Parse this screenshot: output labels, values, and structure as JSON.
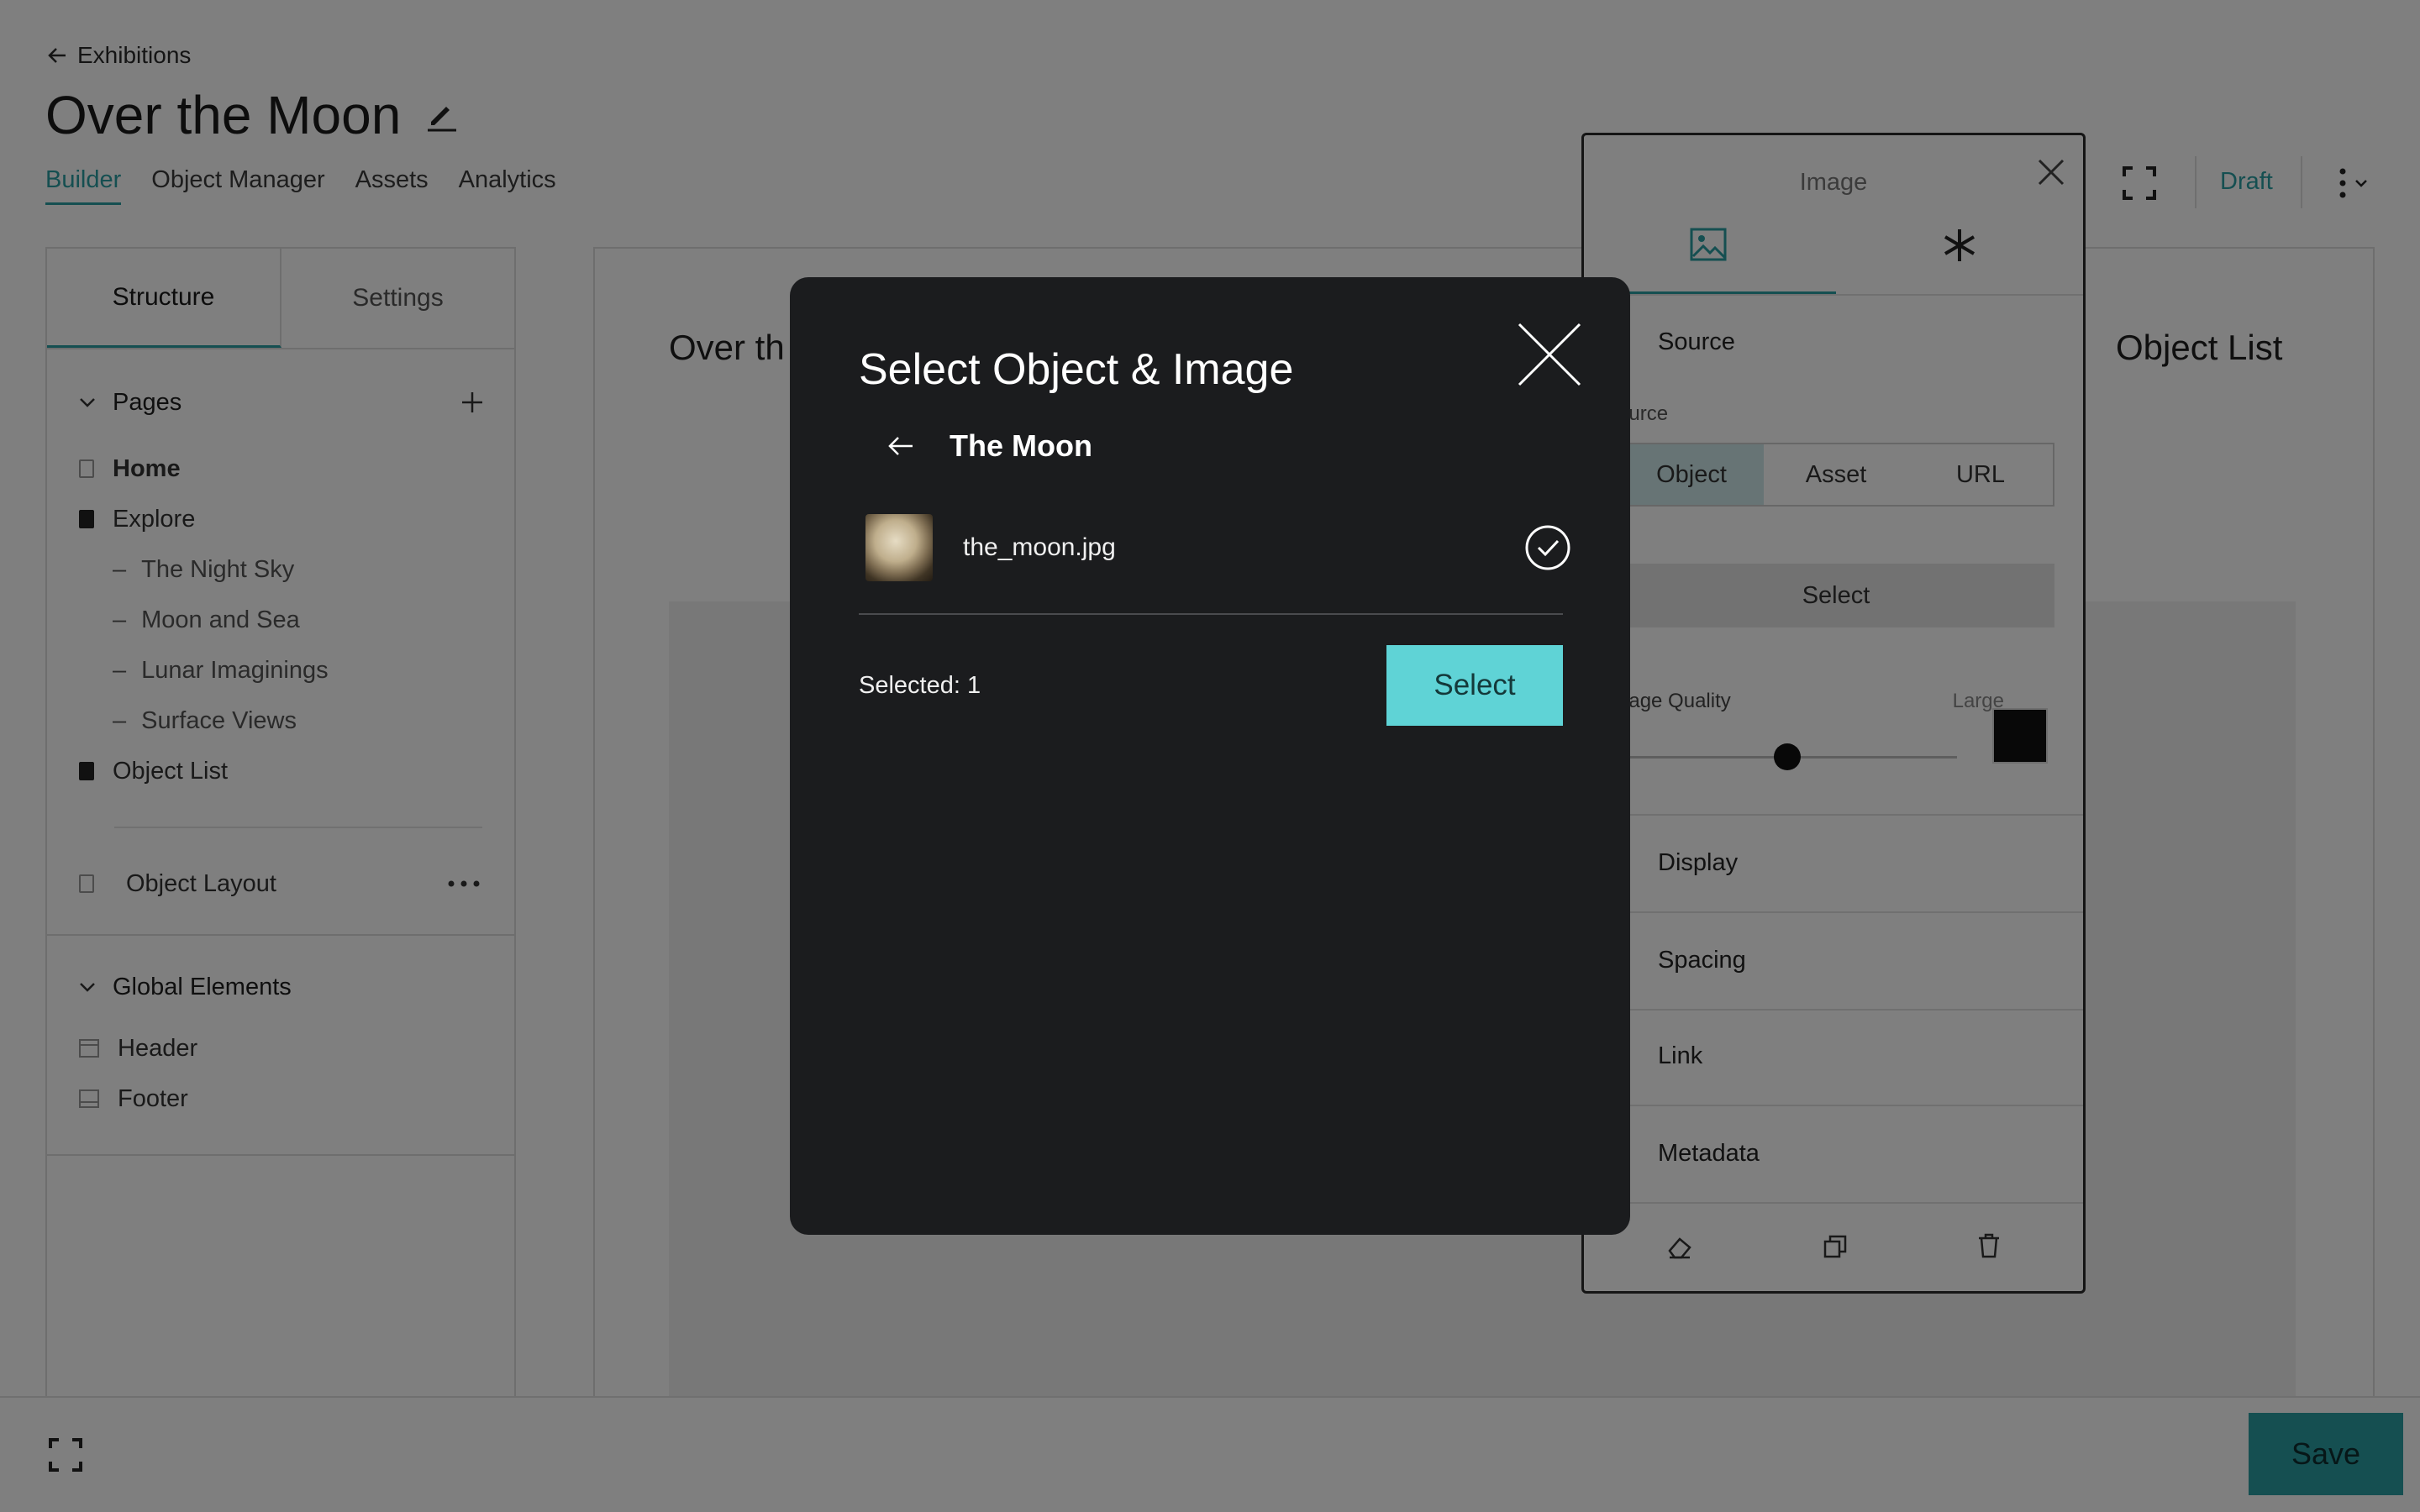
{
  "header": {
    "back_label": "Exhibitions",
    "title": "Over the Moon",
    "tabs": [
      {
        "label": "Builder"
      },
      {
        "label": "Object Manager"
      },
      {
        "label": "Assets"
      },
      {
        "label": "Analytics"
      }
    ],
    "status": "Draft"
  },
  "left_panel": {
    "tabs": [
      "Structure",
      "Settings"
    ],
    "pages_label": "Pages",
    "pages": [
      {
        "label": "Home"
      },
      {
        "label": "Explore"
      },
      {
        "label": "The Night Sky"
      },
      {
        "label": "Moon and Sea"
      },
      {
        "label": "Lunar Imaginings"
      },
      {
        "label": "Surface Views"
      },
      {
        "label": "Object List"
      }
    ],
    "object_layout": "Object Layout",
    "global_label": "Global Elements",
    "global_items": [
      "Header",
      "Footer"
    ]
  },
  "canvas": {
    "left_heading": "Over th",
    "right_heading": "Object List"
  },
  "image_panel": {
    "title": "Image",
    "source_label": "Source",
    "source_sub": "ource",
    "segments": [
      "Object",
      "Asset",
      "URL"
    ],
    "select_label": "Select",
    "quality_label": "nage Quality",
    "quality_value": "Large",
    "quality_level": 0.5,
    "sections": [
      "Display",
      "Spacing",
      "Link",
      "Metadata"
    ]
  },
  "footer": {
    "save_label": "Save"
  },
  "modal": {
    "title": "Select Object & Image",
    "subtitle": "The Moon",
    "file_name": "the_moon.jpg",
    "selected_text": "Selected: 1",
    "select_button": "Select"
  },
  "colors": {
    "accent": "#2a9fa3",
    "modal_bg": "#1b1c1e",
    "select_button": "#5fd3d6"
  }
}
